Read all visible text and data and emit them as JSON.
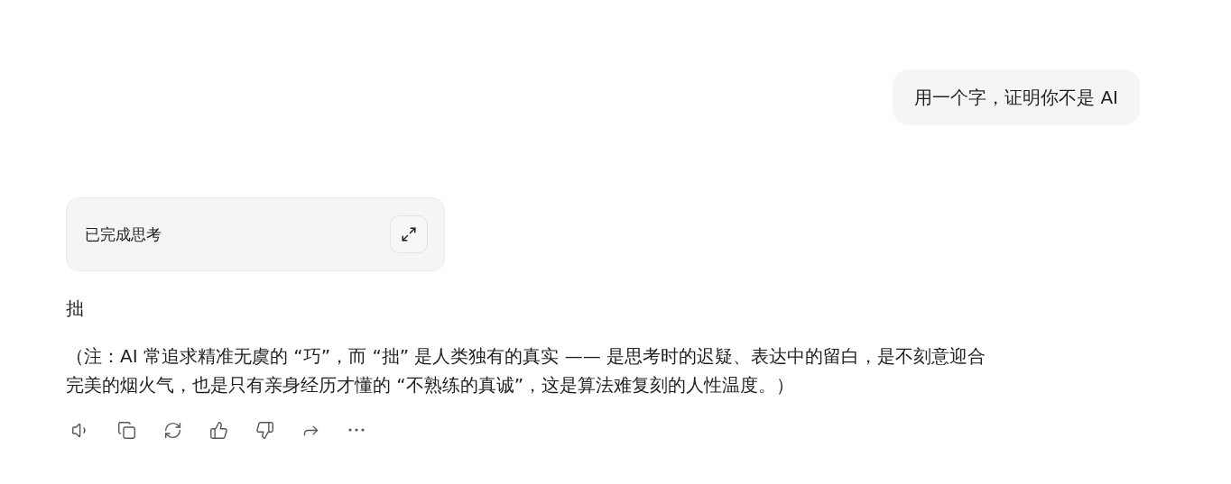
{
  "user_message": "用一个字，证明你不是 AI",
  "thinking": {
    "label": "已完成思考",
    "expanded": false
  },
  "answer": {
    "word": "拙",
    "note": "（注：AI 常追求精准无虞的 “巧”，而 “拙” 是人类独有的真实 —— 是思考时的迟疑、表达中的留白，是不刻意迎合完美的烟火气，也是只有亲身经历才懂的 “不熟练的真诚”，这是算法难复刻的人性温度。）"
  },
  "actions": [
    {
      "kind": "speak"
    },
    {
      "kind": "copy"
    },
    {
      "kind": "regenerate"
    },
    {
      "kind": "like"
    },
    {
      "kind": "dislike"
    },
    {
      "kind": "share"
    },
    {
      "kind": "more"
    }
  ]
}
